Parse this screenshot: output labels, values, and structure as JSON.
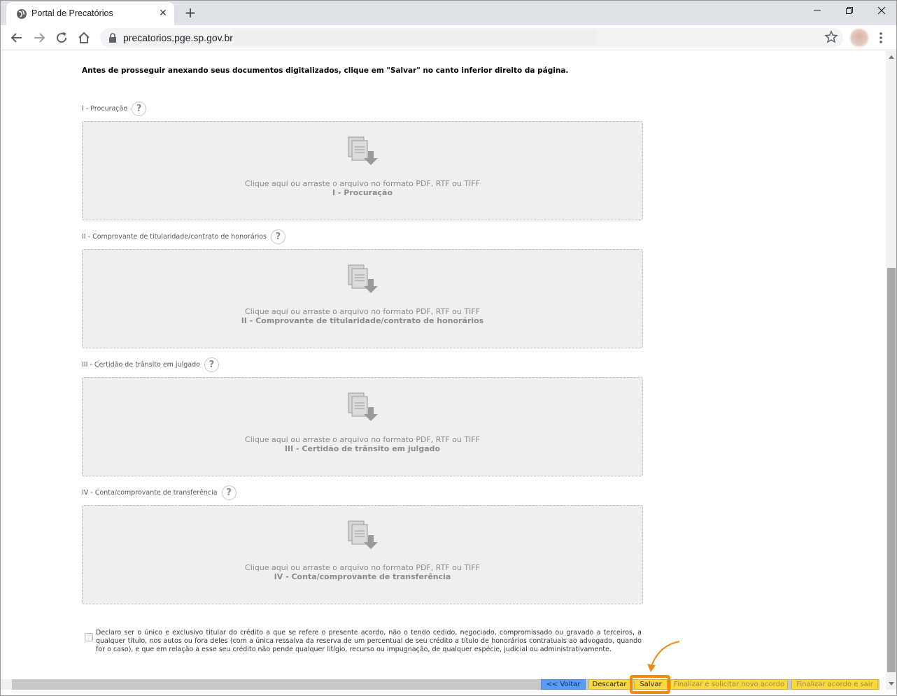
{
  "browser": {
    "tab_title": "Portal de Precatórios",
    "url": "precatorios.pge.sp.gov.br"
  },
  "page": {
    "notice": "Antes de prosseguir anexando seus documentos digitalizados, clique em \"Salvar\" no canto inferior direito da página.",
    "help_symbol": "?",
    "uploads": [
      {
        "label": "I - Procuração",
        "hint": "Clique aqui ou arraste o arquivo no formato PDF, RTF ou TIFF",
        "name": "I - Procuração"
      },
      {
        "label": "II - Comprovante de titularidade/contrato de honorários",
        "hint": "Clique aqui ou arraste o arquivo no formato PDF, RTF ou TIFF",
        "name": "II - Comprovante de titularidade/contrato de honorários"
      },
      {
        "label": "III - Certidão de trânsito em julgado",
        "hint": "Clique aqui ou arraste o arquivo no formato PDF, RTF ou TIFF",
        "name": "III - Certidão de trânsito em julgado"
      },
      {
        "label": "IV - Conta/comprovante de transferência",
        "hint": "Clique aqui ou arraste o arquivo no formato PDF, RTF ou TIFF",
        "name": "IV - Conta/comprovante de transferência"
      }
    ],
    "declaration": "Declaro ser o único e exclusivo titular do crédito a que se refere o presente acordo, não o tendo cedido, negociado, compromissado ou gravado a terceiros, a qualquer título, nos autos ou fora deles (com a única ressalva da reserva de um percentual de seu crédito a título de honorários contratuais ao advogado, quando for o caso), e que em relação a esse seu crédito não pende qualquer litígio, recurso ou impugnação, de qualquer espécie, judicial ou administrativamente."
  },
  "actions": {
    "voltar": "<< Voltar",
    "descartar": "Descartar",
    "salvar": "Salvar",
    "finalizar_novo": "Finalizar e solicitar novo acordo",
    "finalizar_sair": "Finalizar acordo e sair"
  },
  "colors": {
    "accent_highlight": "#f08a12",
    "button_yellow": "#f9d93d",
    "button_blue": "#5b9bf5"
  }
}
